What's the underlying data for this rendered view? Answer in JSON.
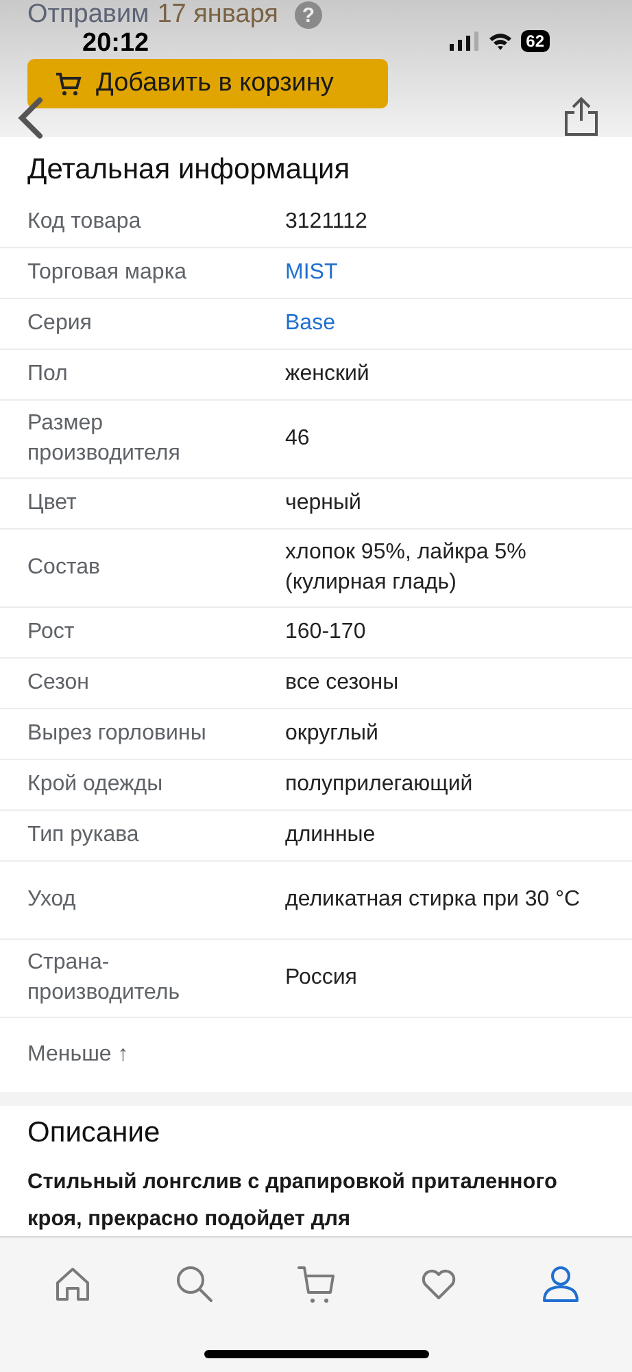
{
  "header": {
    "shipping_label": "Отправим",
    "shipping_date": "17 января",
    "help": "?",
    "add_to_cart": "Добавить в корзину"
  },
  "status_bar": {
    "time": "20:12",
    "battery": "62"
  },
  "details": {
    "title": "Детальная информация",
    "rows": [
      {
        "label": "Код товара",
        "value": "3121112",
        "kind": "text"
      },
      {
        "label": "Торговая марка",
        "value": "MIST",
        "kind": "link"
      },
      {
        "label": "Серия",
        "value": "Base",
        "kind": "link"
      },
      {
        "label": "Пол",
        "value": "женский",
        "kind": "text"
      },
      {
        "label": "Размер производителя",
        "value": "46",
        "kind": "text"
      },
      {
        "label": "Цвет",
        "value": "черный",
        "kind": "text"
      },
      {
        "label": "Состав",
        "value": "хлопок 95%, лайкра 5% (кулирная гладь)",
        "kind": "text"
      },
      {
        "label": "Рост",
        "value": "160-170",
        "kind": "text"
      },
      {
        "label": "Сезон",
        "value": "все сезоны",
        "kind": "text"
      },
      {
        "label": "Вырез горловины",
        "value": "округлый",
        "kind": "text"
      },
      {
        "label": "Крой одежды",
        "value": "полуприлегающий",
        "kind": "text"
      },
      {
        "label": "Тип рукава",
        "value": "длинные",
        "kind": "text"
      },
      {
        "label": "Уход",
        "value": "деликатная стирка при 30 °C",
        "kind": "text"
      },
      {
        "label": "Страна-производитель",
        "value": "Россия",
        "kind": "text"
      }
    ],
    "less": "Меньше ↑"
  },
  "description": {
    "title": "Описание",
    "text": "Стильный лонгслив с драпировкой приталенного кроя, прекрасно подойдет для"
  },
  "tab_bar": [
    {
      "kind": "home",
      "selected": false
    },
    {
      "kind": "search",
      "selected": false
    },
    {
      "kind": "cart",
      "selected": false
    },
    {
      "kind": "favorites",
      "selected": false
    },
    {
      "kind": "profile",
      "selected": true
    }
  ]
}
